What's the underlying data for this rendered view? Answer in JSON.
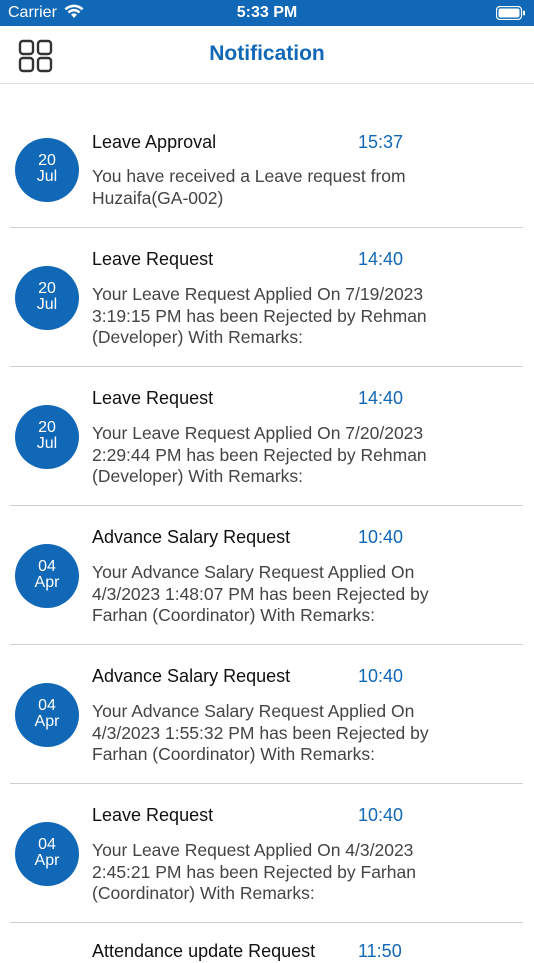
{
  "status_bar": {
    "carrier": "Carrier",
    "time": "5:33 PM"
  },
  "header": {
    "title": "Notification",
    "menu_icon": "grid-icon"
  },
  "notifications": [
    {
      "day": "20",
      "month": "Jul",
      "title": "Leave Approval",
      "time": "15:37",
      "body": " You have received a Leave request from Huzaifa(GA-002)"
    },
    {
      "day": "20",
      "month": "Jul",
      "title": "Leave Request",
      "time": "14:40",
      "body": " Your Leave Request Applied On 7/19/2023 3:19:15 PM has been Rejected by Rehman (Developer) With Remarks:"
    },
    {
      "day": "20",
      "month": "Jul",
      "title": "Leave Request",
      "time": "14:40",
      "body": " Your Leave Request Applied On 7/20/2023 2:29:44 PM has been Rejected by Rehman (Developer) With Remarks:"
    },
    {
      "day": "04",
      "month": "Apr",
      "title": "Advance Salary Request",
      "time": "10:40",
      "body": " Your Advance Salary Request Applied On 4/3/2023 1:48:07 PM has been Rejected by Farhan (Coordinator) With Remarks:"
    },
    {
      "day": "04",
      "month": "Apr",
      "title": "Advance Salary Request",
      "time": "10:40",
      "body": " Your Advance Salary Request Applied On 4/3/2023 1:55:32 PM has been Rejected by Farhan (Coordinator) With Remarks:"
    },
    {
      "day": "04",
      "month": "Apr",
      "title": "Leave Request",
      "time": "10:40",
      "body": " Your Leave Request Applied On 4/3/2023 2:45:21 PM has been Rejected by Farhan (Coordinator) With Remarks:"
    }
  ],
  "partial_row": {
    "title": "Attendance update Request",
    "time": "11:50"
  },
  "colors": {
    "primary": "#1068b7"
  }
}
